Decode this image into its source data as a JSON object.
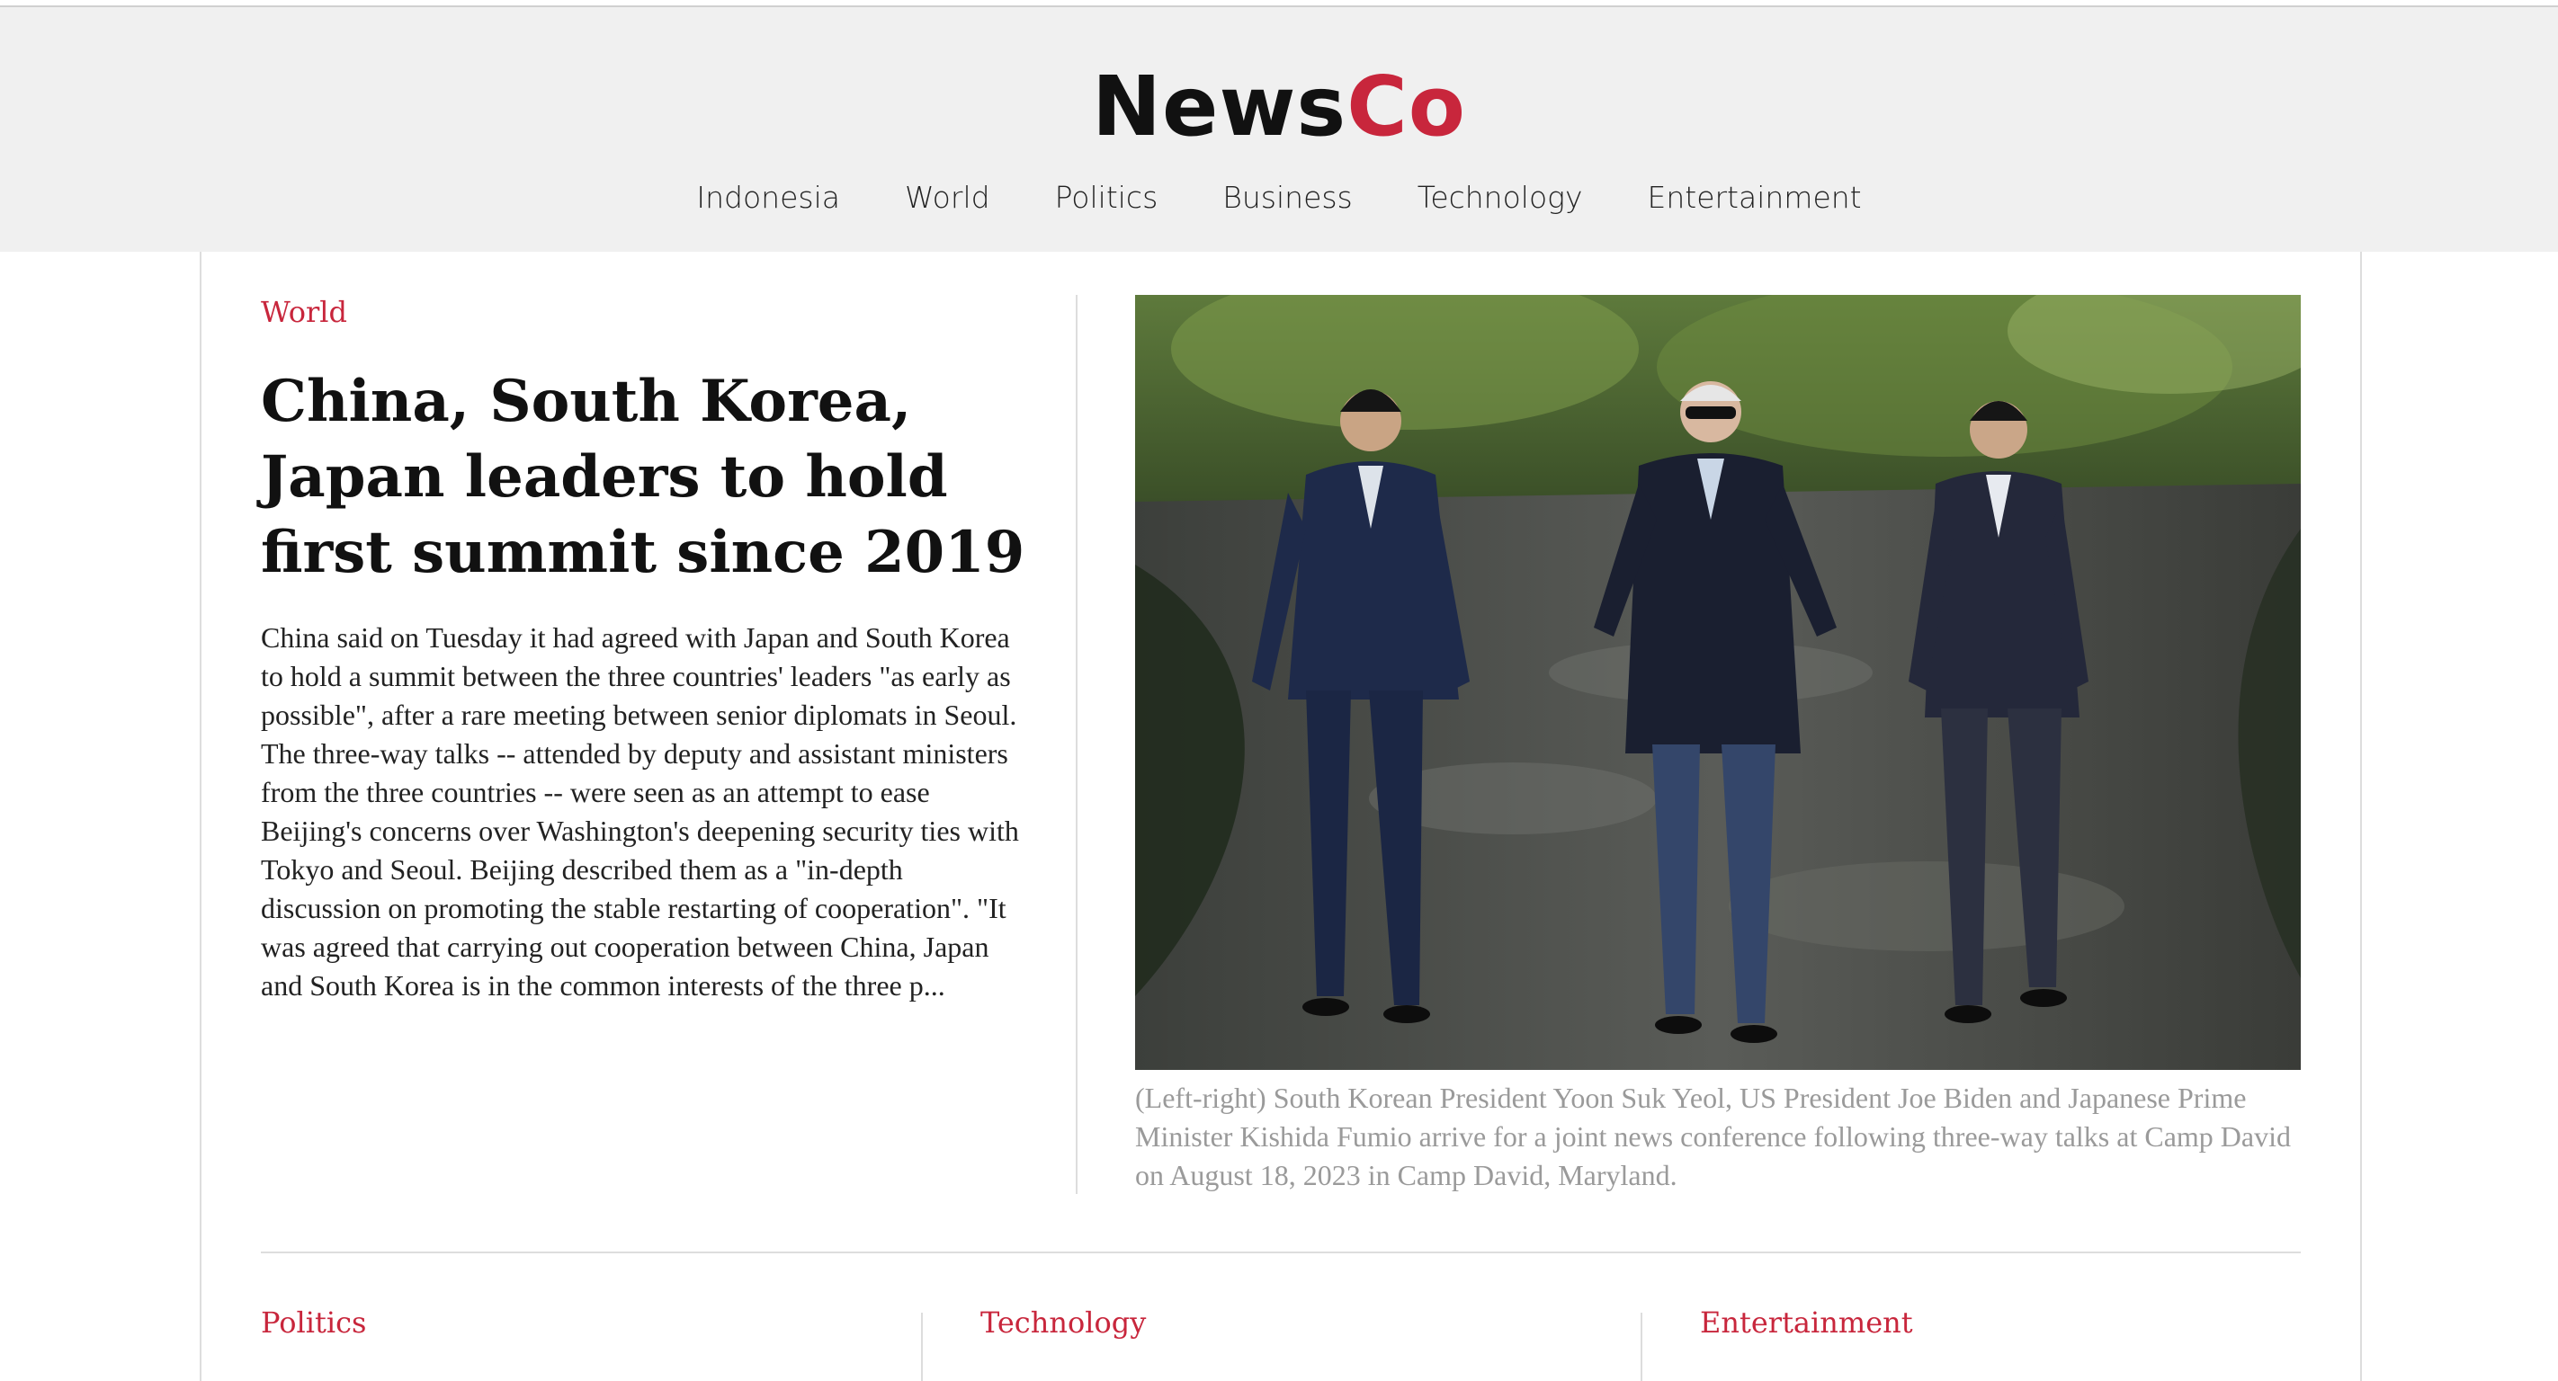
{
  "brand": {
    "part1": "News",
    "part2": "Co"
  },
  "nav": [
    "Indonesia",
    "World",
    "Politics",
    "Business",
    "Technology",
    "Entertainment"
  ],
  "featured": {
    "category": "World",
    "headline": "China, South Korea, Japan leaders to hold first summit since 2019",
    "excerpt": "China said on Tuesday it had agreed with Japan and South Korea to hold a summit between the three countries' leaders \"as early as possible\", after a rare meeting between senior diplomats in Seoul. The three-way talks -- attended by deputy and assistant ministers from the three countries -- were seen as an attempt to ease Beijing's concerns over Washington's deepening security ties with Tokyo and Seoul. Beijing described them as a \"in-depth discussion on promoting the stable restarting of cooperation\". \"It was agreed that carrying out cooperation between China, Japan and South Korea is in the common interests of the three p...",
    "caption": "(Left-right) South Korean President Yoon Suk Yeol, US President Joe Biden and Japanese Prime Minister Kishida Fumio arrive for a joint news conference following three-way talks at Camp David on August 18, 2023 in Camp David, Maryland."
  },
  "sections": [
    "Politics",
    "Technology",
    "Entertainment"
  ],
  "colors": {
    "accent": "#c8263c",
    "header_bg": "#f0f0f0",
    "text": "#111111",
    "caption": "#9a9a9a"
  }
}
